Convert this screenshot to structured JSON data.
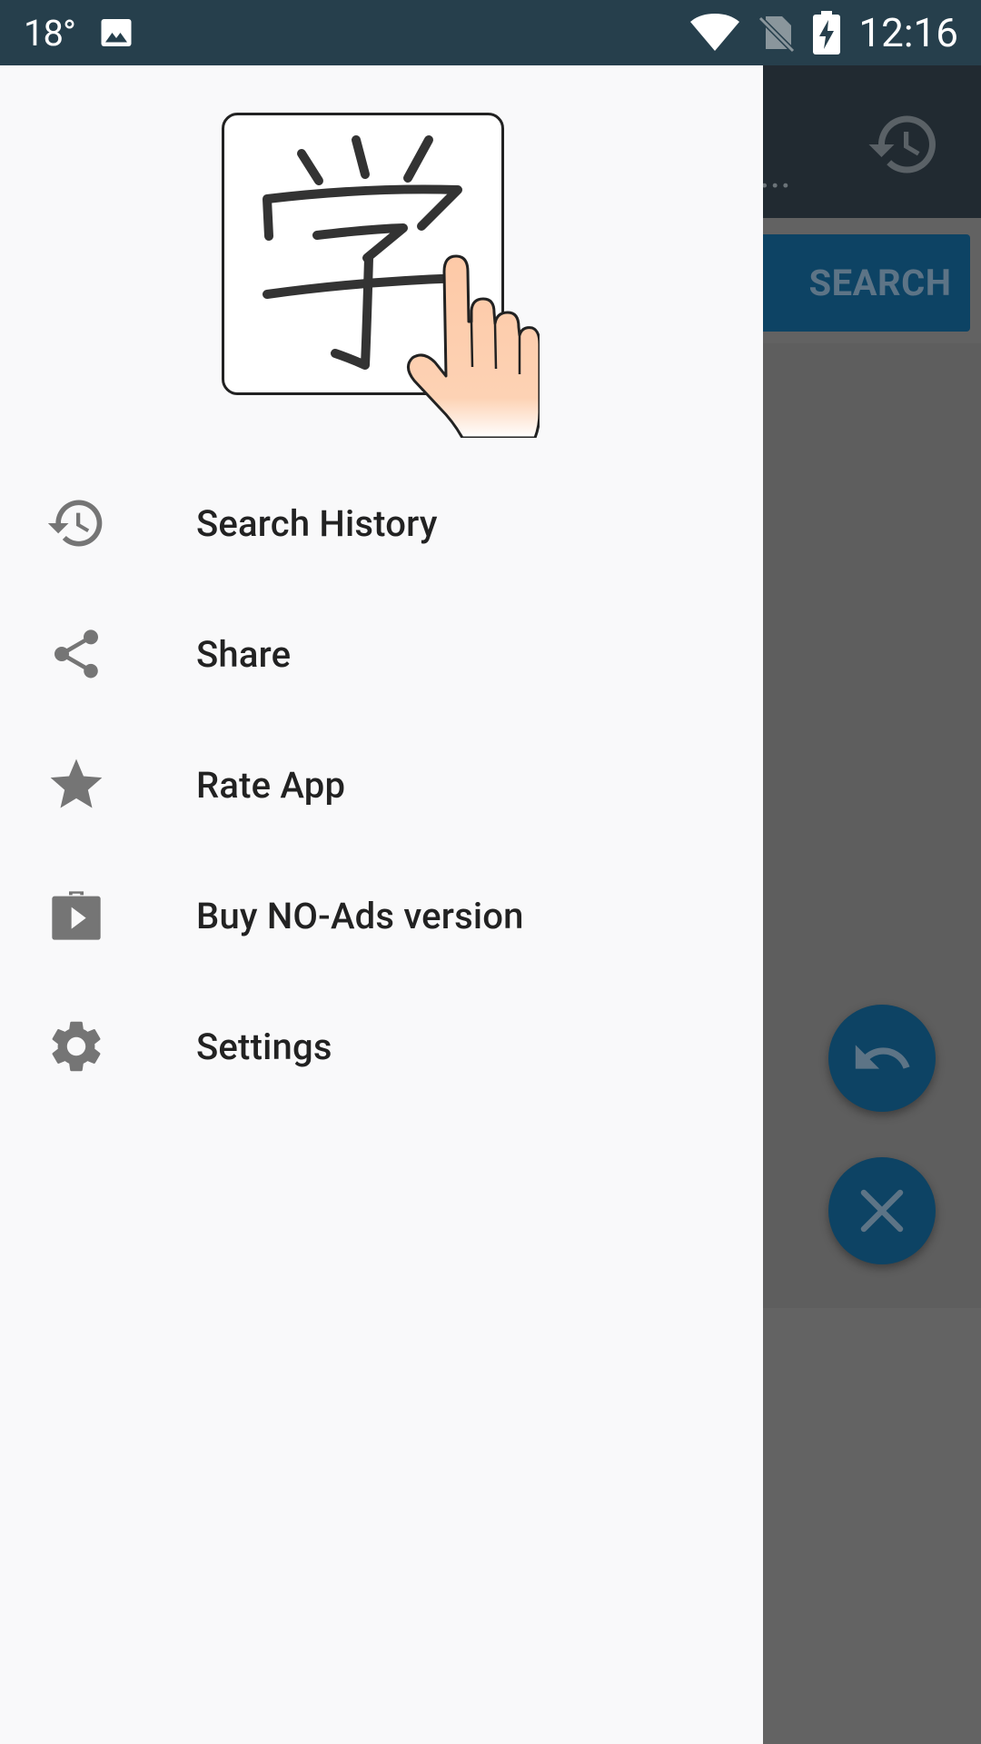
{
  "status_bar": {
    "temperature": "18°",
    "time": "12:16"
  },
  "background_app": {
    "overflow_text": "...",
    "search_label": "SEARCH"
  },
  "drawer": {
    "logo_character": "学",
    "items": [
      {
        "label": "Search History",
        "icon": "history-icon"
      },
      {
        "label": "Share",
        "icon": "share-icon"
      },
      {
        "label": "Rate App",
        "icon": "star-icon"
      },
      {
        "label": "Buy NO-Ads version",
        "icon": "play-store-icon"
      },
      {
        "label": "Settings",
        "icon": "gear-icon"
      }
    ]
  },
  "colors": {
    "status_bar": "#263f4c",
    "drawer_bg": "#f9f9fa",
    "accent": "#0d4364",
    "scrim_bg": "#626262",
    "icon_gray": "#757575"
  }
}
